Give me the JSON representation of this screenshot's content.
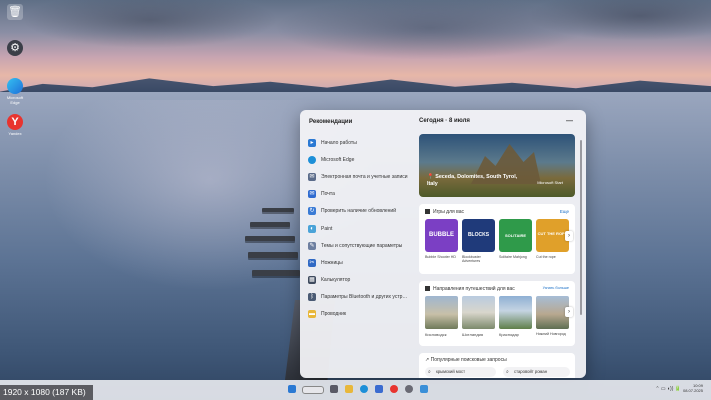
{
  "desktop": {
    "icons": [
      {
        "label": "",
        "icon": "recycle-bin-icon"
      },
      {
        "label": "",
        "icon": "settings-app-icon"
      },
      {
        "label": "Microsoft Edge",
        "icon": "edge-icon"
      },
      {
        "label": "Yandex",
        "icon": "yandex-browser-icon"
      }
    ]
  },
  "widgets": {
    "recommendations_title": "Рекомендации",
    "recommendations": [
      {
        "label": "Начало работы",
        "icon": "start-icon",
        "color": "#2b79d3"
      },
      {
        "label": "Microsoft Edge",
        "icon": "edge-icon",
        "color": "#1d8fd8"
      },
      {
        "label": "Электронная почта и учетные записи",
        "icon": "mail-icon",
        "color": "#5a6b8a"
      },
      {
        "label": "Почта",
        "icon": "mail-app-icon",
        "color": "#2f6bd0"
      },
      {
        "label": "Проверить наличие обновлений",
        "icon": "update-icon",
        "color": "#3a7bd5"
      },
      {
        "label": "Paint",
        "icon": "paint-icon",
        "color": "#4aa3d8"
      },
      {
        "label": "Темы и сопутствующие параметры",
        "icon": "brush-icon",
        "color": "#6d7fa0"
      },
      {
        "label": "Ножницы",
        "icon": "snip-icon",
        "color": "#3069c4"
      },
      {
        "label": "Калькулятор",
        "icon": "calculator-icon",
        "color": "#3e4a5e"
      },
      {
        "label": "Параметры Bluetooth и других устр…",
        "icon": "bluetooth-icon",
        "color": "#4a5a74"
      },
      {
        "label": "Проводник",
        "icon": "folder-icon",
        "color": "#e8b73a"
      }
    ],
    "date_line": "Сегодня · 8 июля",
    "minimize_label": "—",
    "hero": {
      "caption": "Seceda, Dolomites, South Tyrol, Italy",
      "brand": "Microsoft Start"
    },
    "games": {
      "title": "Игры для вас",
      "more": "Еще",
      "tiles": [
        {
          "name": "BUBBLE",
          "label": "Bubble Shooter HD",
          "color": "#7b3fc4"
        },
        {
          "name": "BLOCKS",
          "label": "Blockbuster Adventures",
          "color": "#1f3a7a"
        },
        {
          "name": "SOLITAIRE",
          "label": "Solitaire Mahjong",
          "color": "#2f9a4a"
        },
        {
          "name": "CUT THE ROPE",
          "label": "Cut the rope",
          "color": "#e0a02a"
        }
      ]
    },
    "travel": {
      "title": "Направления путешествий для вас",
      "more": "Узнать больше",
      "places": [
        {
          "label": "Кисловодск",
          "color": "#8aa2c0"
        },
        {
          "label": "Шотландия",
          "color": "#9fb2c8"
        },
        {
          "label": "Краснодар",
          "color": "#6f8fa8"
        },
        {
          "label": "Нижний Новгород",
          "color": "#7d97b3"
        }
      ]
    },
    "searches": {
      "title": "Популярные поисковые запросы",
      "queries": [
        "крымский мост",
        "старовойт роман"
      ]
    }
  },
  "taskbar": {
    "time": "10:09",
    "date": "08.07.2025"
  },
  "caption": "1920 x 1080 (187 KB)"
}
